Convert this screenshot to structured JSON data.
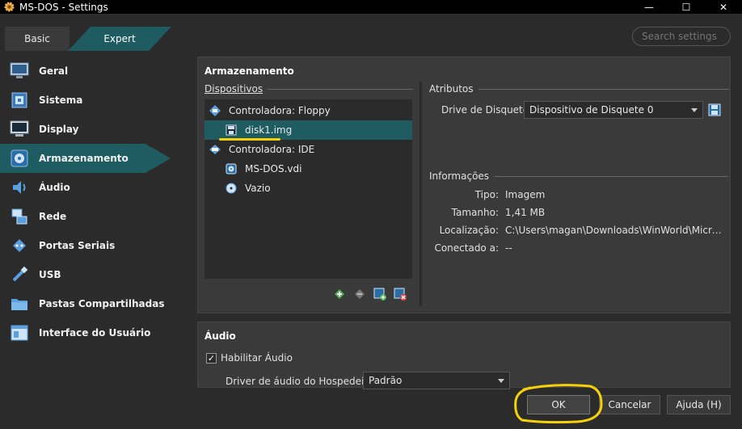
{
  "window": {
    "title": "MS-DOS - Settings",
    "controls": {
      "minimize": "—",
      "maximize": "☐",
      "close": "✕"
    }
  },
  "mode_tabs": {
    "basic": "Basic",
    "expert": "Expert"
  },
  "search": {
    "placeholder": "Search settings"
  },
  "sidebar": {
    "items": [
      {
        "label": "Geral",
        "icon": "general-icon"
      },
      {
        "label": "Sistema",
        "icon": "system-icon"
      },
      {
        "label": "Display",
        "icon": "display-icon"
      },
      {
        "label": "Armazenamento",
        "icon": "storage-icon",
        "active": true
      },
      {
        "label": "Áudio",
        "icon": "audio-icon"
      },
      {
        "label": "Rede",
        "icon": "network-icon"
      },
      {
        "label": "Portas Seriais",
        "icon": "serial-ports-icon"
      },
      {
        "label": "USB",
        "icon": "usb-icon"
      },
      {
        "label": "Pastas Compartilhadas",
        "icon": "shared-folders-icon"
      },
      {
        "label": "Interface do Usuário",
        "icon": "user-interface-icon"
      }
    ]
  },
  "storage": {
    "title": "Armazenamento",
    "devices_label": "Dispositivos",
    "tree": [
      {
        "label": "Controladora: Floppy",
        "icon": "floppy-controller-icon",
        "level": 0
      },
      {
        "label": "disk1.img",
        "icon": "floppy-disk-icon",
        "level": 1,
        "selected": true
      },
      {
        "label": "Controladora: IDE",
        "icon": "ide-controller-icon",
        "level": 0
      },
      {
        "label": "MS-DOS.vdi",
        "icon": "hard-disk-icon",
        "level": 1
      },
      {
        "label": "Vazio",
        "icon": "optical-disc-icon",
        "level": 1
      }
    ],
    "attributes": {
      "label": "Atributos",
      "drive_label": "Drive de Disquete:",
      "drive_value": "Dispositivo de Disquete 0"
    },
    "information": {
      "label": "Informações",
      "rows": [
        {
          "key": "Tipo:",
          "value": "Imagem"
        },
        {
          "key": "Tamanho:",
          "value": "1,41 MB"
        },
        {
          "key": "Localização:",
          "value": "C:\\Users\\magan\\Downloads\\WinWorld\\Microsof..."
        },
        {
          "key": "Conectado a:",
          "value": "--"
        }
      ]
    }
  },
  "audio": {
    "title": "Áudio",
    "enable_label": "Habilitar Áudio",
    "enabled": true,
    "driver_label": "Driver de áudio do Hospedeiro:",
    "driver_value": "Padrão"
  },
  "buttons": {
    "ok": "OK",
    "cancel": "Cancelar",
    "help": "Ajuda (H)"
  },
  "colors": {
    "accent": "#1e5c62",
    "annotation": "#f5d00a",
    "background": "#2b2b2b",
    "panel": "#3a3a3a"
  }
}
